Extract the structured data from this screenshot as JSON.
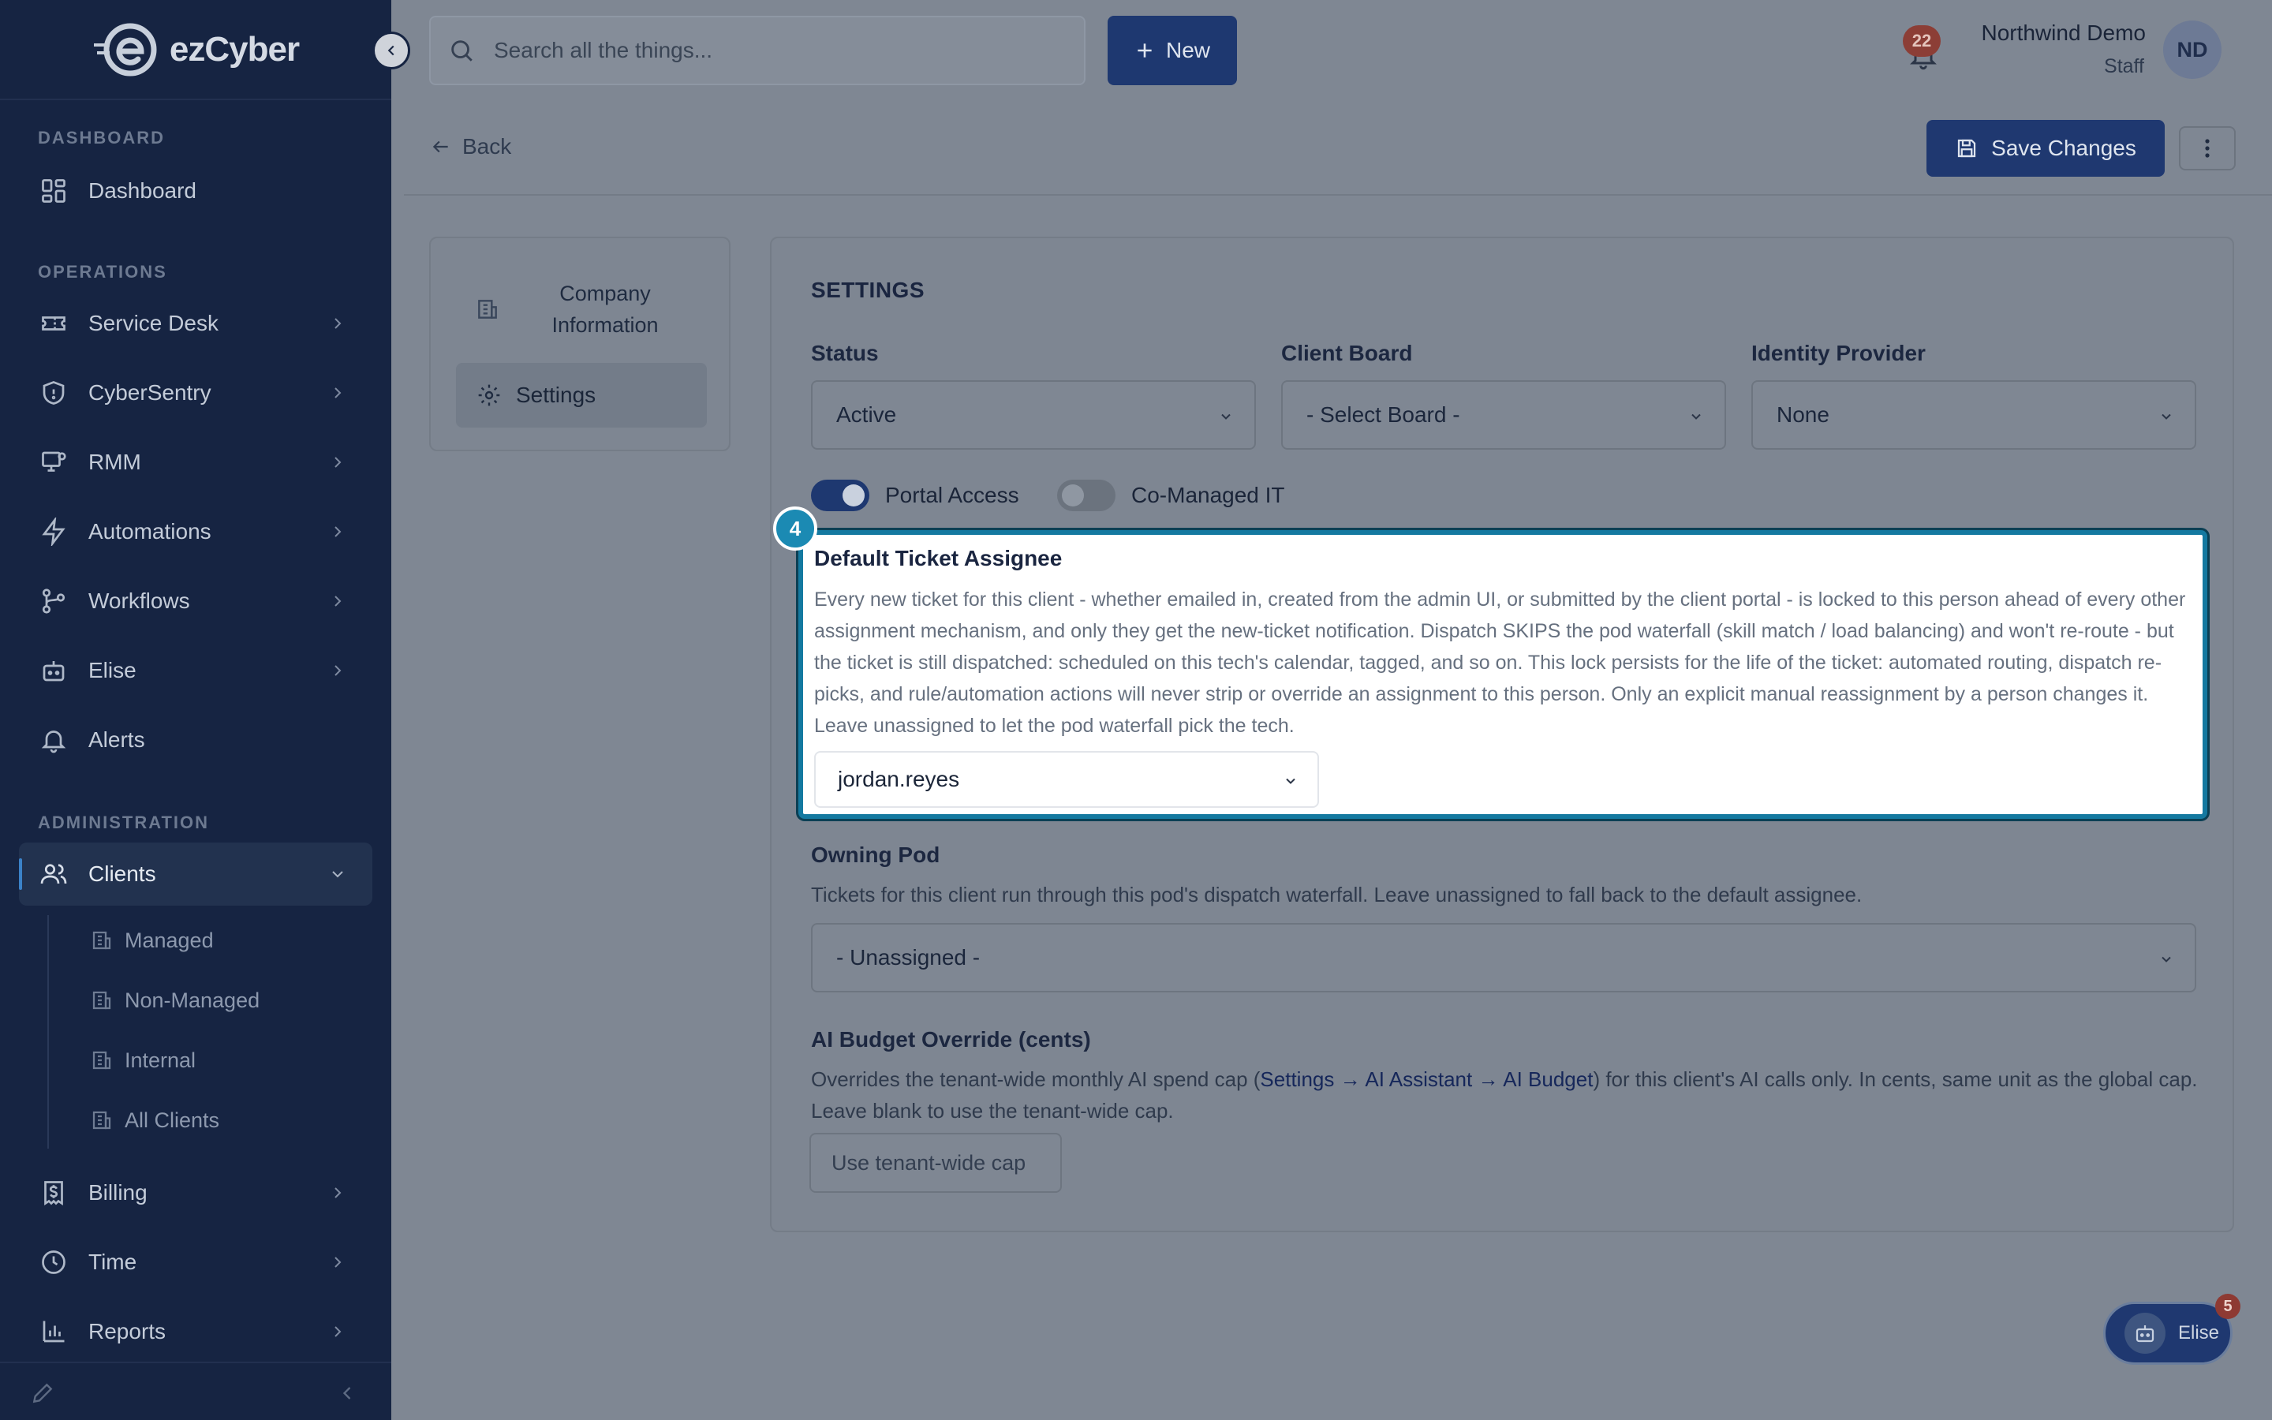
{
  "app": {
    "brand": "ezCyber"
  },
  "sidebar": {
    "sections": {
      "dashboard": "DASHBOARD",
      "operations": "OPERATIONS",
      "administration": "ADMINISTRATION"
    },
    "items": {
      "dashboard": "Dashboard",
      "service_desk": "Service Desk",
      "cybersentry": "CyberSentry",
      "rmm": "RMM",
      "automations": "Automations",
      "workflows": "Workflows",
      "elise": "Elise",
      "alerts": "Alerts",
      "clients": "Clients",
      "billing": "Billing",
      "time": "Time",
      "reports": "Reports"
    },
    "clients_sub": [
      "Managed",
      "Non-Managed",
      "Internal",
      "All Clients"
    ],
    "active_item": "Clients"
  },
  "topbar": {
    "search_placeholder": "Search all the things...",
    "new_label": "New",
    "notifications_count": "22",
    "user_name": "Northwind Demo",
    "user_role": "Staff",
    "user_initials": "ND"
  },
  "subheader": {
    "back_label": "Back",
    "save_label": "Save Changes"
  },
  "tabs": {
    "company": "Company Information",
    "settings": "Settings"
  },
  "settings": {
    "heading": "SETTINGS",
    "status": {
      "label": "Status",
      "value": "Active"
    },
    "client_board": {
      "label": "Client Board",
      "value": "- Select Board -"
    },
    "identity_provider": {
      "label": "Identity Provider",
      "value": "None"
    },
    "portal_access": {
      "label": "Portal Access",
      "enabled": true
    },
    "co_managed": {
      "label": "Co-Managed IT",
      "enabled": false
    },
    "default_assignee": {
      "step": "4",
      "label": "Default Ticket Assignee",
      "description": "Every new ticket for this client - whether emailed in, created from the admin UI, or submitted by the client portal - is locked to this person ahead of every other assignment mechanism, and only they get the new-ticket notification. Dispatch SKIPS the pod waterfall (skill match / load balancing) and won't re-route - but the ticket is still dispatched: scheduled on this tech's calendar, tagged, and so on. This lock persists for the life of the ticket: automated routing, dispatch re-picks, and rule/automation actions will never strip or override an assignment to this person. Only an explicit manual reassignment by a person changes it. Leave unassigned to let the pod waterfall pick the tech.",
      "value": "jordan.reyes"
    },
    "owning_pod": {
      "label": "Owning Pod",
      "description": "Tickets for this client run through this pod's dispatch waterfall. Leave unassigned to fall back to the default assignee.",
      "value": "- Unassigned -"
    },
    "ai_budget": {
      "label": "AI Budget Override (cents)",
      "desc_before": "Overrides the tenant-wide monthly AI spend cap (",
      "desc_link": "Settings → AI Assistant → AI Budget",
      "desc_after": ") for this client's AI calls only. In cents, same unit as the global cap. Leave blank to use the tenant-wide cap.",
      "placeholder": "Use tenant-wide cap"
    }
  },
  "assistant": {
    "label": "Elise",
    "badge": "5"
  }
}
